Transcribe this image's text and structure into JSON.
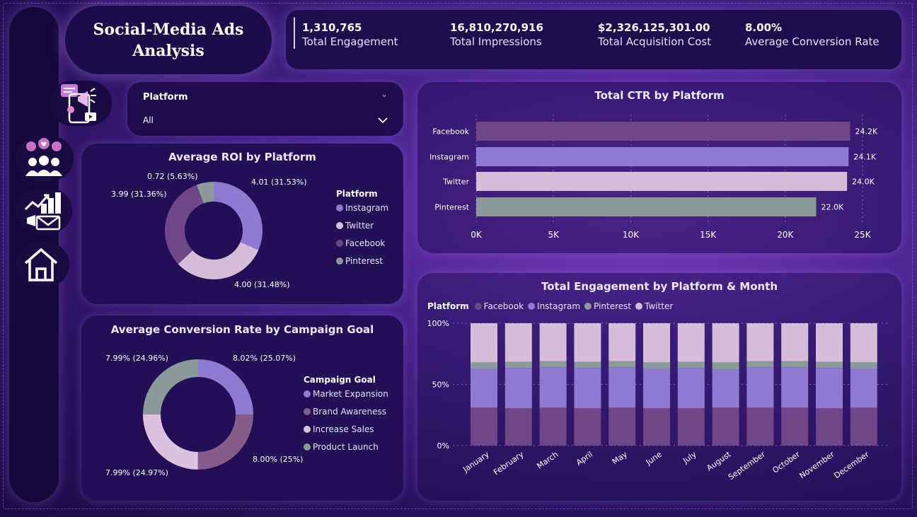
{
  "title": "Social-Media Ads Analysis",
  "title_line1": "Social-Media Ads",
  "title_line2": "Analysis",
  "kpis": [
    {
      "value": "1,310,765",
      "label": "Total Engagement"
    },
    {
      "value": "16,810,270,916",
      "label": "Total Impressions"
    },
    {
      "value": "$2,326,125,301.00",
      "label": "Total Acquisition Cost"
    },
    {
      "value": "8.00%",
      "label": "Average Conversion Rate"
    }
  ],
  "nav": [
    {
      "icon": "megaphone-social-icon"
    },
    {
      "icon": "people-heart-icon"
    },
    {
      "icon": "growth-chart-icon"
    },
    {
      "icon": "home-icon"
    }
  ],
  "slicer": {
    "label": "Platform",
    "value": "All"
  },
  "colors": {
    "instagram": "#8e7ad0",
    "twitter": "#d6bcd9",
    "facebook": "#714688",
    "pinterest": "#8a9a98",
    "market_expansion": "#8e7ad0",
    "brand_awareness": "#875c8a",
    "increase_sales": "#dcc2dd",
    "product_launch": "#8a9a98"
  },
  "chart_data": [
    {
      "type": "pie",
      "title": "Average ROI by Platform",
      "legend_title": "Platform",
      "legend_placement": "right",
      "slices": [
        {
          "name": "Instagram",
          "value": 4.01,
          "label": "4.01 (31.53%)"
        },
        {
          "name": "Twitter",
          "value": 4.0,
          "label": "4.00 (31.48%)"
        },
        {
          "name": "Facebook",
          "value": 3.99,
          "label": "3.99 (31.36%)"
        },
        {
          "name": "Pinterest",
          "value": 0.72,
          "label": "0.72 (5.63%)"
        }
      ]
    },
    {
      "type": "pie",
      "title": "Average Conversion Rate by Campaign Goal",
      "legend_title": "Campaign Goal",
      "legend_placement": "right",
      "slices": [
        {
          "name": "Market Expansion",
          "value": 8.02,
          "label": "8.02% (25.07%)"
        },
        {
          "name": "Brand Awareness",
          "value": 8.0,
          "label": "8.00% (25%)"
        },
        {
          "name": "Increase Sales",
          "value": 7.99,
          "label": "7.99% (24.97%)"
        },
        {
          "name": "Product Launch",
          "value": 7.99,
          "label": "7.99% (24.96%)"
        }
      ]
    },
    {
      "type": "bar",
      "orientation": "horizontal",
      "title": "Total CTR by Platform",
      "categories": [
        "Facebook",
        "Instagram",
        "Twitter",
        "Pinterest"
      ],
      "values": [
        24200,
        24100,
        24000,
        22000
      ],
      "data_labels": [
        "24.2K",
        "24.1K",
        "24.0K",
        "22.0K"
      ],
      "xlim": [
        0,
        25000
      ],
      "xticks": [
        "0K",
        "5K",
        "10K",
        "15K",
        "20K",
        "25K"
      ],
      "grid": true
    },
    {
      "type": "bar",
      "stacked": "100%",
      "title": "Total Engagement by Platform & Month",
      "legend_title": "Platform",
      "legend_placement": "top-left",
      "categories": [
        "January",
        "February",
        "March",
        "April",
        "May",
        "June",
        "July",
        "August",
        "September",
        "October",
        "November",
        "December"
      ],
      "yticks": [
        "0%",
        "50%",
        "100%"
      ],
      "series": [
        {
          "name": "Facebook",
          "values": [
            31,
            30.5,
            31,
            30.5,
            31,
            30.5,
            30.5,
            31,
            31,
            31,
            30.5,
            31
          ]
        },
        {
          "name": "Instagram",
          "values": [
            32,
            33,
            33,
            33,
            33,
            32.5,
            33,
            31,
            33,
            33,
            33,
            32
          ]
        },
        {
          "name": "Pinterest",
          "values": [
            5,
            5,
            5,
            5,
            5,
            5,
            5,
            6,
            5,
            5,
            5,
            5
          ]
        },
        {
          "name": "Twitter",
          "values": [
            32,
            31.5,
            31,
            31.5,
            31,
            32,
            31.5,
            32,
            31,
            31,
            31.5,
            32
          ]
        }
      ]
    }
  ]
}
